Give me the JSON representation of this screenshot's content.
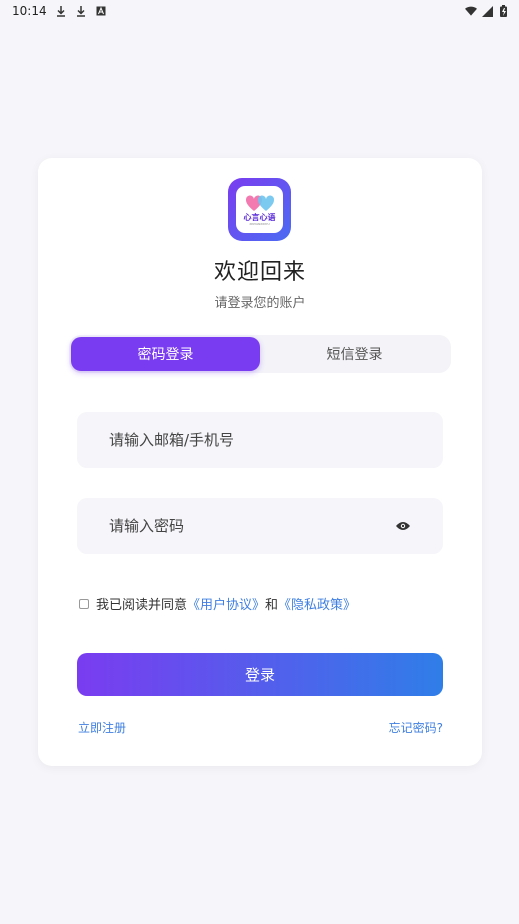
{
  "status_bar": {
    "time": "10:14",
    "left_icons": [
      "download-icon",
      "download-icon",
      "a-icon"
    ],
    "right_icons": [
      "wifi-icon",
      "signal-icon",
      "battery-icon"
    ]
  },
  "logo": {
    "wordmark": "心言心语",
    "subtitle": "XINYANXINYU"
  },
  "header": {
    "title": "欢迎回来",
    "subtitle": "请登录您的账户"
  },
  "tabs": [
    {
      "label": "密码登录",
      "active": true
    },
    {
      "label": "短信登录",
      "active": false
    }
  ],
  "form": {
    "account_placeholder": "请输入邮箱/手机号",
    "account_value": "",
    "password_placeholder": "请输入密码",
    "password_value": "",
    "password_toggle_icon": "eye-icon"
  },
  "agreement": {
    "prefix": "我已阅读并同意",
    "user_agreement": "《用户协议》",
    "conjunction": "和",
    "privacy_policy": "《隐私政策》",
    "checked": false
  },
  "actions": {
    "login_label": "登录",
    "register_label": "立即注册",
    "forgot_label": "忘记密码?"
  },
  "colors": {
    "accent_purple": "#7a3cf0",
    "accent_blue": "#2f7ee8",
    "link": "#3f7fe0",
    "background": "#f6f6fa"
  }
}
